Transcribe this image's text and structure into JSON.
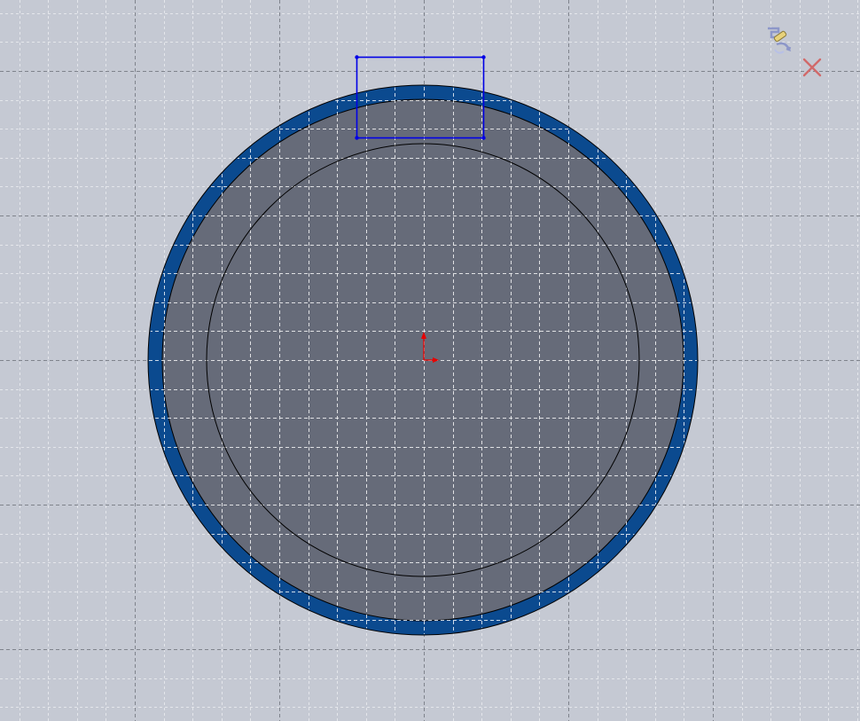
{
  "app": {
    "view": "sketch-editing-viewport"
  },
  "colors": {
    "background": "#c5c9d3",
    "major_grid": "#7f838c",
    "minor_grid": "#ffffff",
    "part_face": "#666b79",
    "outer_ring": "#0b4a8f",
    "sketch_line": "#0000e6",
    "sketch_point": "#0000e6",
    "edge": "#000000",
    "origin": "#e60000",
    "cancel_x": "#d16a6a",
    "confirm_icon": "#8d97c9"
  },
  "icons": {
    "confirm": "confirm-sketch-icon",
    "cancel": "exit-sketch-icon",
    "origin": "origin-axes-icon"
  }
}
